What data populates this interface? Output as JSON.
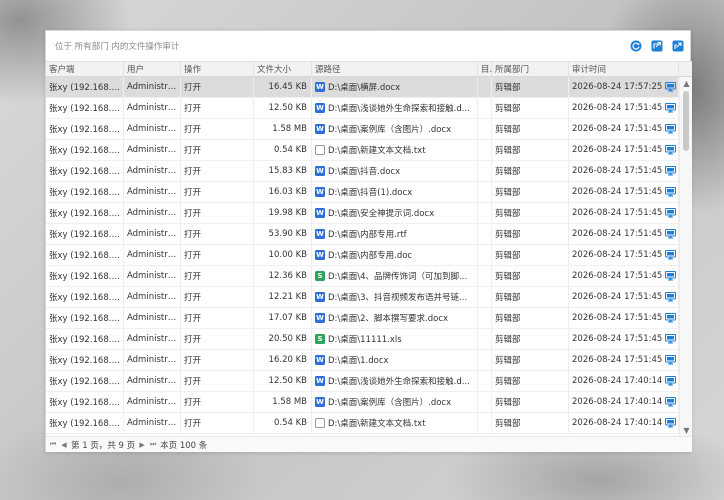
{
  "panel": {
    "title": "位于 所有部门 内的文件操作审计"
  },
  "columns": [
    "客户端",
    "用户",
    "操作",
    "文件大小",
    "源路径",
    "目.",
    "所属部门",
    "审计时间"
  ],
  "rows": [
    {
      "client": "张xy (192.168.3...",
      "user": "Administra...",
      "op": "打开",
      "size": "16.45 KB",
      "icon": "word",
      "path": "D:\\桌面\\横屏.docx",
      "dept": "剪辑部",
      "time": "2026-08-24 17:57:25"
    },
    {
      "client": "张xy (192.168.3...",
      "user": "Administra...",
      "op": "打开",
      "size": "12.50 KB",
      "icon": "word",
      "path": "D:\\桌面\\浅谈她外生命探索和接触.d...",
      "dept": "剪辑部",
      "time": "2026-08-24 17:51:45"
    },
    {
      "client": "张xy (192.168.3...",
      "user": "Administra...",
      "op": "打开",
      "size": "1.58 MB",
      "icon": "word",
      "path": "D:\\桌面\\案例库（含图片）.docx",
      "dept": "剪辑部",
      "time": "2026-08-24 17:51:45"
    },
    {
      "client": "张xy (192.168.3...",
      "user": "Administra...",
      "op": "打开",
      "size": "0.54 KB",
      "icon": "txt",
      "path": "D:\\桌面\\新建文本文档.txt",
      "dept": "剪辑部",
      "time": "2026-08-24 17:51:45"
    },
    {
      "client": "张xy (192.168.3...",
      "user": "Administra...",
      "op": "打开",
      "size": "15.83 KB",
      "icon": "word",
      "path": "D:\\桌面\\抖音.docx",
      "dept": "剪辑部",
      "time": "2026-08-24 17:51:45"
    },
    {
      "client": "张xy (192.168.3...",
      "user": "Administra...",
      "op": "打开",
      "size": "16.03 KB",
      "icon": "word",
      "path": "D:\\桌面\\抖音(1).docx",
      "dept": "剪辑部",
      "time": "2026-08-24 17:51:45"
    },
    {
      "client": "张xy (192.168.3...",
      "user": "Administra...",
      "op": "打开",
      "size": "19.98 KB",
      "icon": "word",
      "path": "D:\\桌面\\安全神提示词.docx",
      "dept": "剪辑部",
      "time": "2026-08-24 17:51:45"
    },
    {
      "client": "张xy (192.168.3...",
      "user": "Administra...",
      "op": "打开",
      "size": "53.90 KB",
      "icon": "word",
      "path": "D:\\桌面\\内部专用.rtf",
      "dept": "剪辑部",
      "time": "2026-08-24 17:51:45"
    },
    {
      "client": "张xy (192.168.3...",
      "user": "Administra...",
      "op": "打开",
      "size": "10.00 KB",
      "icon": "word",
      "path": "D:\\桌面\\内部专用.doc",
      "dept": "剪辑部",
      "time": "2026-08-24 17:51:45"
    },
    {
      "client": "张xy (192.168.3...",
      "user": "Administra...",
      "op": "打开",
      "size": "12.36 KB",
      "icon": "excel",
      "path": "D:\\桌面\\4、品牌传饰词（可加到脚...",
      "dept": "剪辑部",
      "time": "2026-08-24 17:51:45"
    },
    {
      "client": "张xy (192.168.3...",
      "user": "Administra...",
      "op": "打开",
      "size": "12.21 KB",
      "icon": "word",
      "path": "D:\\桌面\\3、抖音视频发布语并号链...",
      "dept": "剪辑部",
      "time": "2026-08-24 17:51:45"
    },
    {
      "client": "张xy (192.168.3...",
      "user": "Administra...",
      "op": "打开",
      "size": "17.07 KB",
      "icon": "word",
      "path": "D:\\桌面\\2、脚本撰写要求.docx",
      "dept": "剪辑部",
      "time": "2026-08-24 17:51:45"
    },
    {
      "client": "张xy (192.168.3...",
      "user": "Administra...",
      "op": "打开",
      "size": "20.50 KB",
      "icon": "excel",
      "path": "D:\\桌面\\11111.xls",
      "dept": "剪辑部",
      "time": "2026-08-24 17:51:45"
    },
    {
      "client": "张xy (192.168.3...",
      "user": "Administra...",
      "op": "打开",
      "size": "16.20 KB",
      "icon": "word",
      "path": "D:\\桌面\\1.docx",
      "dept": "剪辑部",
      "time": "2026-08-24 17:51:45"
    },
    {
      "client": "张xy (192.168.3...",
      "user": "Administra...",
      "op": "打开",
      "size": "12.50 KB",
      "icon": "word",
      "path": "D:\\桌面\\浅谈她外生命探索和接触.d...",
      "dept": "剪辑部",
      "time": "2026-08-24 17:40:14"
    },
    {
      "client": "张xy (192.168.3...",
      "user": "Administra...",
      "op": "打开",
      "size": "1.58 MB",
      "icon": "word",
      "path": "D:\\桌面\\案例库（含图片）.docx",
      "dept": "剪辑部",
      "time": "2026-08-24 17:40:14"
    },
    {
      "client": "张xy (192.168.3...",
      "user": "Administra...",
      "op": "打开",
      "size": "0.54 KB",
      "icon": "txt",
      "path": "D:\\桌面\\新建文本文档.txt",
      "dept": "剪辑部",
      "time": "2026-08-24 17:40:14"
    }
  ],
  "selected_row": 0,
  "pager": {
    "page_info": "第 1 页，共 9 页",
    "per_page": "本页 100 条"
  },
  "colors": {
    "accent": "#1e7fd6",
    "selected_row": "#dcdcdc",
    "word": "#2f6fd6",
    "excel": "#2da55a"
  },
  "icons": {
    "refresh": "refresh-icon",
    "export": "export-icon",
    "share": "share-icon",
    "client": "monitor-icon"
  }
}
